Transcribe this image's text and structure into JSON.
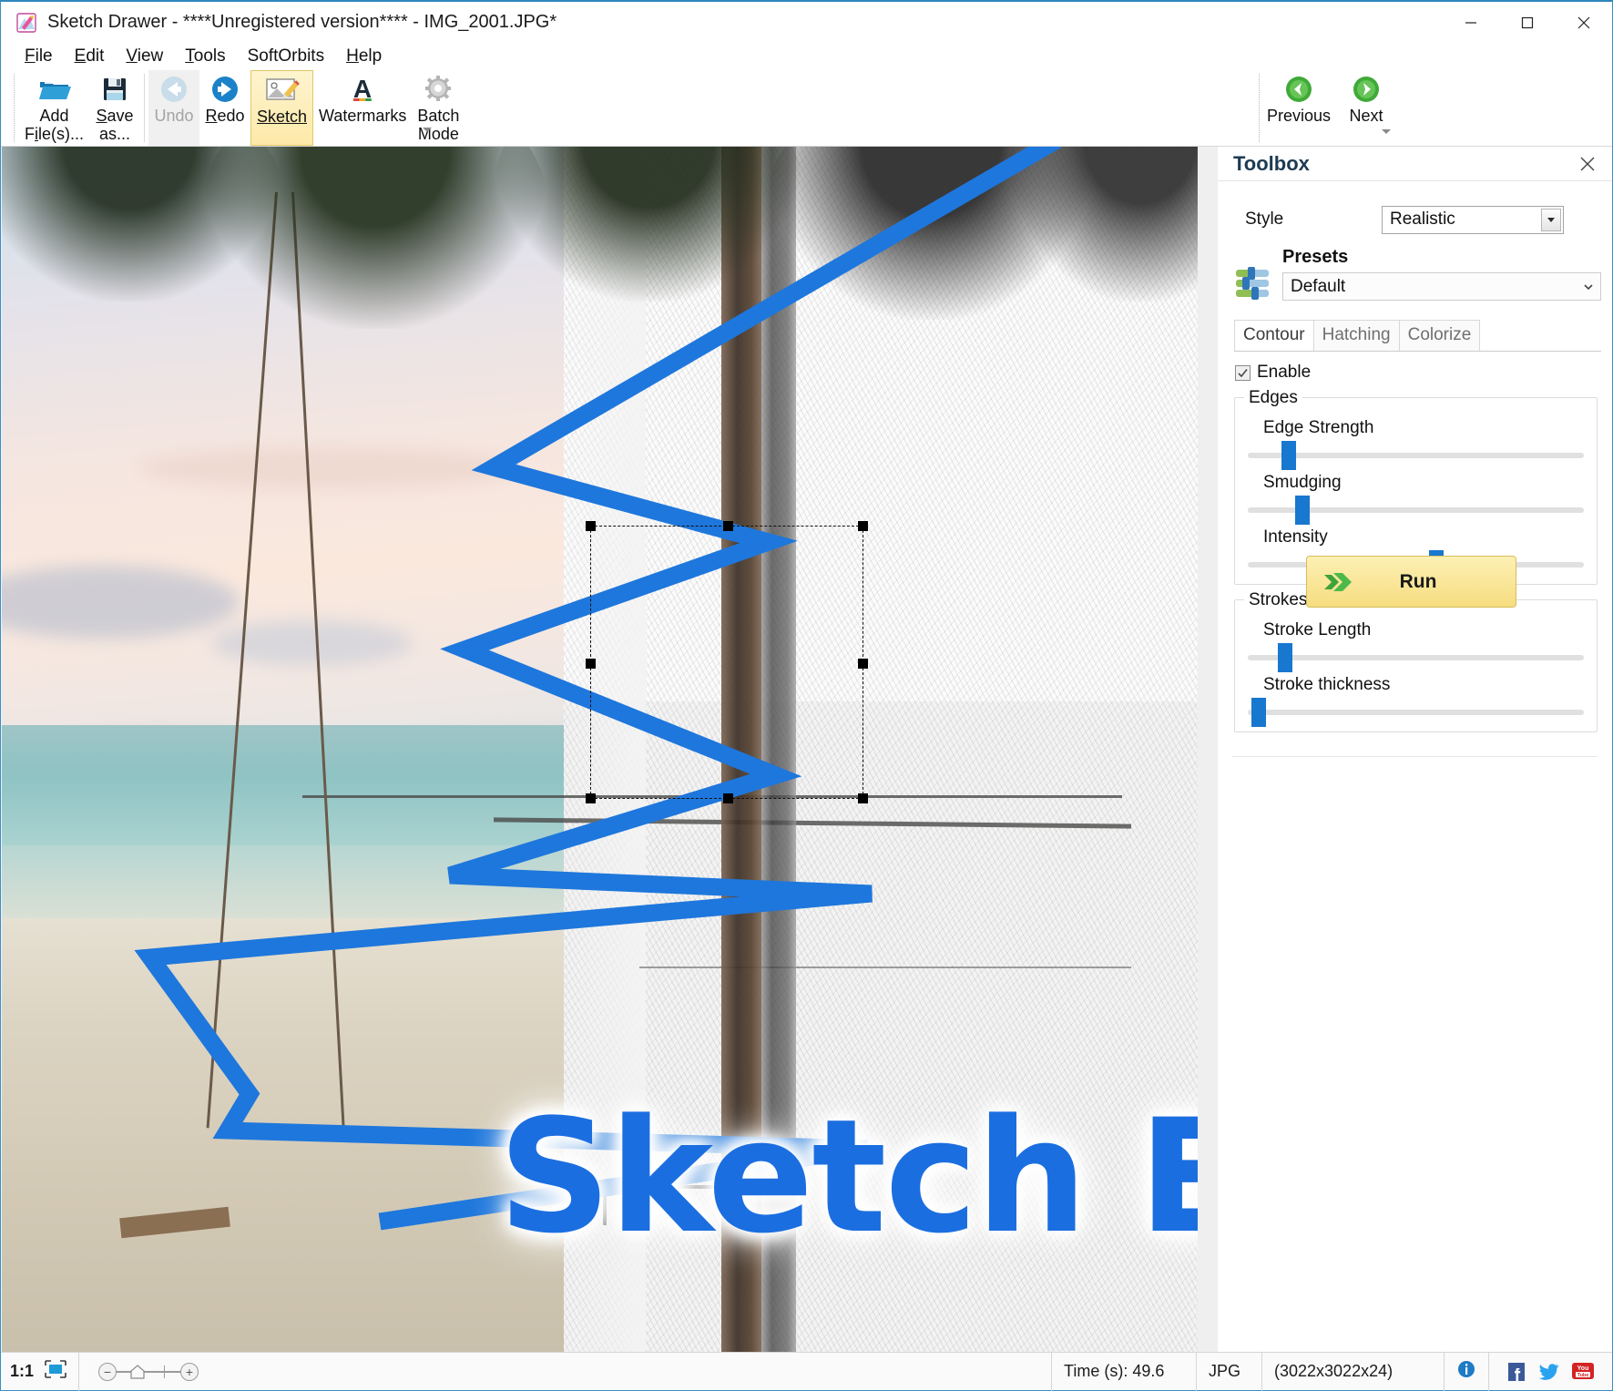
{
  "window": {
    "title": "Sketch Drawer - ****Unregistered version**** - IMG_2001.JPG*",
    "icon": "sketch-drawer-app-icon",
    "minimize": "minimize-icon",
    "maximize": "maximize-icon",
    "close": "close-icon"
  },
  "menu": {
    "items": [
      {
        "label": "File",
        "accel": "F"
      },
      {
        "label": "Edit",
        "accel": "E"
      },
      {
        "label": "View",
        "accel": "V"
      },
      {
        "label": "Tools",
        "accel": "T"
      },
      {
        "label": "SoftOrbits",
        "accel": ""
      },
      {
        "label": "Help",
        "accel": "H"
      }
    ]
  },
  "toolbar": {
    "add_files": {
      "line1": "Add",
      "line2": "File(s)...",
      "icon": "open-folder-icon"
    },
    "save_as": {
      "line1": "Save",
      "line2": "as...",
      "icon": "floppy-disk-icon"
    },
    "undo": {
      "label": "Undo",
      "icon": "undo-arrow-icon",
      "disabled": true
    },
    "redo": {
      "label": "Redo",
      "icon": "redo-arrow-icon",
      "disabled": false
    },
    "sketch": {
      "label": "Sketch",
      "icon": "sketch-picture-pencil-icon",
      "selected": true
    },
    "watermarks": {
      "label": "Watermarks",
      "icon": "letter-a-watermark-icon"
    },
    "batch_mode": {
      "line1": "Batch",
      "line2": "Mode",
      "icon": "gear-icon"
    },
    "previous": {
      "label": "Previous",
      "icon": "green-left-arrow-icon"
    },
    "next": {
      "label": "Next",
      "icon": "green-right-arrow-icon"
    }
  },
  "canvas": {
    "watermark_text": "Sketch Effect",
    "watermark_color": "#1b6ee0",
    "zigzag_color": "#1e77dc",
    "selection": "watermark-selection-box"
  },
  "toolbox": {
    "title": "Toolbox",
    "close": "close-icon",
    "style_label": "Style",
    "style_value": "Realistic",
    "style_options": [
      "Realistic"
    ],
    "presets_label": "Presets",
    "presets_value": "Default",
    "presets_options": [
      "Default"
    ],
    "presets_icon": "sliders-icon",
    "tabs": [
      {
        "label": "Contour",
        "active": true
      },
      {
        "label": "Hatching",
        "active": false
      },
      {
        "label": "Colorize",
        "active": false
      }
    ],
    "enable_label": "Enable",
    "enable_checked": true,
    "groups": [
      {
        "name": "Edges",
        "sliders": [
          {
            "label": "Edge Strength",
            "percent": 10
          },
          {
            "label": "Smudging",
            "percent": 14
          },
          {
            "label": "Intensity",
            "percent": 54
          }
        ]
      },
      {
        "name": "Strokes",
        "sliders": [
          {
            "label": "Stroke Length",
            "percent": 9
          },
          {
            "label": "Stroke thickness",
            "percent": 1
          }
        ]
      }
    ],
    "run_label": "Run",
    "run_icon": "green-double-arrow-icon",
    "run_color": "#f6dd80"
  },
  "status": {
    "zoom_ratio": "1:1",
    "fit_icon": "fit-to-screen-icon",
    "zoom_out_icon": "minus-icon",
    "zoom_in_icon": "plus-icon",
    "time": "Time (s): 49.6",
    "format": "JPG",
    "dimensions": "(3022x3022x24)",
    "info_icon": "info-icon",
    "facebook_icon": "facebook-icon",
    "twitter_icon": "twitter-icon",
    "youtube_icon": "youtube-icon"
  }
}
